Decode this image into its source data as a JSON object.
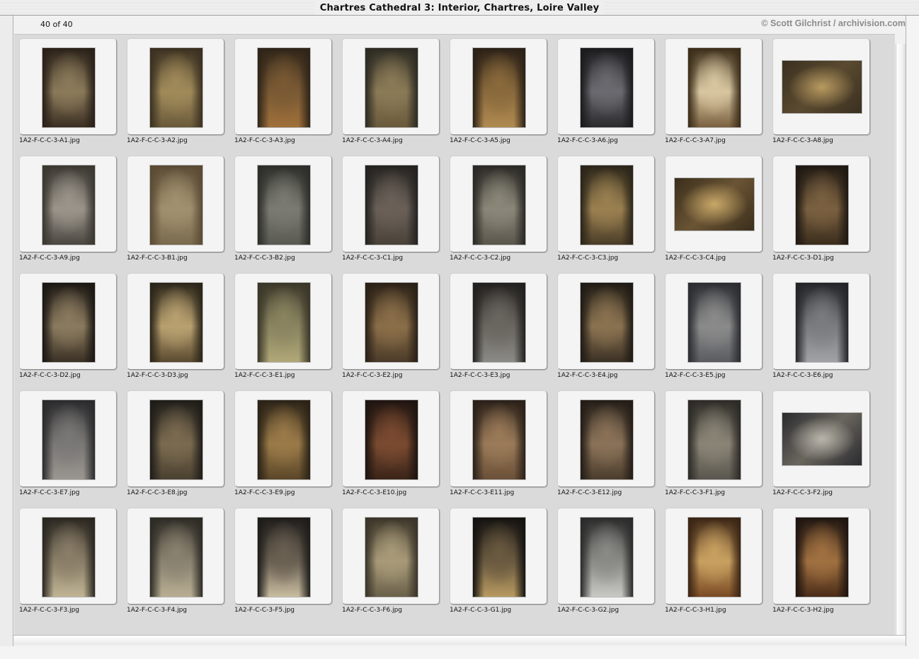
{
  "window": {
    "title": "Chartres Cathedral 3: Interior, Chartres, Loire Valley"
  },
  "header": {
    "count": "40 of 40",
    "copyright": "© Scott Gilchrist / archivision.com"
  },
  "thumbnails": [
    {
      "filename": "1A2-F-C-C-3-A1.jpg",
      "orientation": "portrait",
      "colors": [
        "#2a2018",
        "#8a7a5a",
        "#3a2e22"
      ]
    },
    {
      "filename": "1A2-F-C-C-3-A2.jpg",
      "orientation": "portrait",
      "colors": [
        "#3a3020",
        "#a08a5a",
        "#6a5a3a"
      ]
    },
    {
      "filename": "1A2-F-C-C-3-A3.jpg",
      "orientation": "portrait",
      "colors": [
        "#2e2418",
        "#7a5a34",
        "#a0703a"
      ]
    },
    {
      "filename": "1A2-F-C-C-3-A4.jpg",
      "orientation": "portrait",
      "colors": [
        "#2c2a22",
        "#8a7a56",
        "#6a5a3c"
      ]
    },
    {
      "filename": "1A2-F-C-C-3-A5.jpg",
      "orientation": "portrait",
      "colors": [
        "#2a2016",
        "#8a6a3c",
        "#b08a50"
      ]
    },
    {
      "filename": "1A2-F-C-C-3-A6.jpg",
      "orientation": "portrait",
      "colors": [
        "#1a1a1c",
        "#6a6a70",
        "#2a2a2c"
      ]
    },
    {
      "filename": "1A2-F-C-C-3-A7.jpg",
      "orientation": "portrait",
      "colors": [
        "#3a2c18",
        "#d8c6a0",
        "#7a6040"
      ]
    },
    {
      "filename": "1A2-F-C-C-3-A8.jpg",
      "orientation": "landscape",
      "colors": [
        "#3a3020",
        "#b89a60",
        "#5a4a30"
      ]
    },
    {
      "filename": "1A2-F-C-C-3-A9.jpg",
      "orientation": "portrait",
      "colors": [
        "#3a3630",
        "#9a948a",
        "#4a4640"
      ]
    },
    {
      "filename": "1A2-F-C-C-3-B1.jpg",
      "orientation": "portrait",
      "colors": [
        "#5a4a34",
        "#a0906e",
        "#7a6a4e"
      ]
    },
    {
      "filename": "1A2-F-C-C-3-B2.jpg",
      "orientation": "portrait",
      "colors": [
        "#2c2c28",
        "#7a7a72",
        "#5a5a54"
      ]
    },
    {
      "filename": "1A2-F-C-C-3-C1.jpg",
      "orientation": "portrait",
      "colors": [
        "#242220",
        "#6a6058",
        "#4a4238"
      ]
    },
    {
      "filename": "1A2-F-C-C-3-C2.jpg",
      "orientation": "portrait",
      "colors": [
        "#2a2824",
        "#8a8678",
        "#5a564c"
      ]
    },
    {
      "filename": "1A2-F-C-C-3-C3.jpg",
      "orientation": "portrait",
      "colors": [
        "#2a2418",
        "#9a8050",
        "#4a3c28"
      ]
    },
    {
      "filename": "1A2-F-C-C-3-C4.jpg",
      "orientation": "landscape",
      "colors": [
        "#3a2e1c",
        "#c8a868",
        "#6a5434"
      ]
    },
    {
      "filename": "1A2-F-C-C-3-D1.jpg",
      "orientation": "portrait",
      "colors": [
        "#1e1812",
        "#7a6040",
        "#3a2c1c"
      ]
    },
    {
      "filename": "1A2-F-C-C-3-D2.jpg",
      "orientation": "portrait",
      "colors": [
        "#1a1612",
        "#8a7a5e",
        "#3a3024"
      ]
    },
    {
      "filename": "1A2-F-C-C-3-D3.jpg",
      "orientation": "portrait",
      "colors": [
        "#2a2418",
        "#b8a070",
        "#5a4a30"
      ]
    },
    {
      "filename": "1A2-F-C-C-3-E1.jpg",
      "orientation": "portrait",
      "colors": [
        "#3a3628",
        "#8a8460",
        "#b0a878"
      ]
    },
    {
      "filename": "1A2-F-C-C-3-E2.jpg",
      "orientation": "portrait",
      "colors": [
        "#2a2016",
        "#8a6e48",
        "#4a3a28"
      ]
    },
    {
      "filename": "1A2-F-C-C-3-E3.jpg",
      "orientation": "portrait",
      "colors": [
        "#22201e",
        "#6a6660",
        "#8a8a86"
      ]
    },
    {
      "filename": "1A2-F-C-C-3-E4.jpg",
      "orientation": "portrait",
      "colors": [
        "#1e1a14",
        "#8a7250",
        "#3a3024"
      ]
    },
    {
      "filename": "1A2-F-C-C-3-E5.jpg",
      "orientation": "portrait",
      "colors": [
        "#2a2c30",
        "#8a8a8a",
        "#5a5c60"
      ]
    },
    {
      "filename": "1A2-F-C-C-3-E6.jpg",
      "orientation": "portrait",
      "colors": [
        "#222428",
        "#7a7c80",
        "#a0a2a6"
      ]
    },
    {
      "filename": "1A2-F-C-C-3-E7.jpg",
      "orientation": "portrait",
      "colors": [
        "#2a2a2c",
        "#7a7876",
        "#9a9690"
      ]
    },
    {
      "filename": "1A2-F-C-C-3-E8.jpg",
      "orientation": "portrait",
      "colors": [
        "#1e1c18",
        "#7a6a50",
        "#4a4030"
      ]
    },
    {
      "filename": "1A2-F-C-C-3-E9.jpg",
      "orientation": "portrait",
      "colors": [
        "#2a2216",
        "#9a7a48",
        "#5a4628"
      ]
    },
    {
      "filename": "1A2-F-C-C-3-E10.jpg",
      "orientation": "portrait",
      "colors": [
        "#1e1410",
        "#7a4a30",
        "#3a2418"
      ]
    },
    {
      "filename": "1A2-F-C-C-3-E11.jpg",
      "orientation": "portrait",
      "colors": [
        "#2a2018",
        "#9a7a58",
        "#6a5038"
      ]
    },
    {
      "filename": "1A2-F-C-C-3-E12.jpg",
      "orientation": "portrait",
      "colors": [
        "#221c16",
        "#8a7258",
        "#4a3c2c"
      ]
    },
    {
      "filename": "1A2-F-C-C-3-F1.jpg",
      "orientation": "portrait",
      "colors": [
        "#2c2a26",
        "#8a8476",
        "#5a564e"
      ]
    },
    {
      "filename": "1A2-F-C-C-3-F2.jpg",
      "orientation": "landscape",
      "colors": [
        "#2a2a2e",
        "#b8b4aa",
        "#6a665e"
      ]
    },
    {
      "filename": "1A2-F-C-C-3-F3.jpg",
      "orientation": "portrait",
      "colors": [
        "#2a2620",
        "#8a7e68",
        "#c0b494"
      ]
    },
    {
      "filename": "1A2-F-C-C-3-F4.jpg",
      "orientation": "portrait",
      "colors": [
        "#2c2a24",
        "#8a8270",
        "#b8ae92"
      ]
    },
    {
      "filename": "1A2-F-C-C-3-F5.jpg",
      "orientation": "portrait",
      "colors": [
        "#1e1c1a",
        "#6a6052",
        "#c8bca0"
      ]
    },
    {
      "filename": "1A2-F-C-C-3-F6.jpg",
      "orientation": "portrait",
      "colors": [
        "#3a3428",
        "#a89a78",
        "#6a604a"
      ]
    },
    {
      "filename": "1A2-F-C-C-3-G1.jpg",
      "orientation": "portrait",
      "colors": [
        "#141210",
        "#6a5a40",
        "#b89a60"
      ]
    },
    {
      "filename": "1A2-F-C-C-3-G2.jpg",
      "orientation": "portrait",
      "colors": [
        "#2a2a2a",
        "#8a8a86",
        "#c8c8c4"
      ]
    },
    {
      "filename": "1A2-F-C-C-3-H1.jpg",
      "orientation": "portrait",
      "colors": [
        "#3a2414",
        "#c8a060",
        "#7a4a24"
      ]
    },
    {
      "filename": "1A2-F-C-C-3-H2.jpg",
      "orientation": "portrait",
      "colors": [
        "#1e1410",
        "#a07040",
        "#4a2c18"
      ]
    }
  ]
}
